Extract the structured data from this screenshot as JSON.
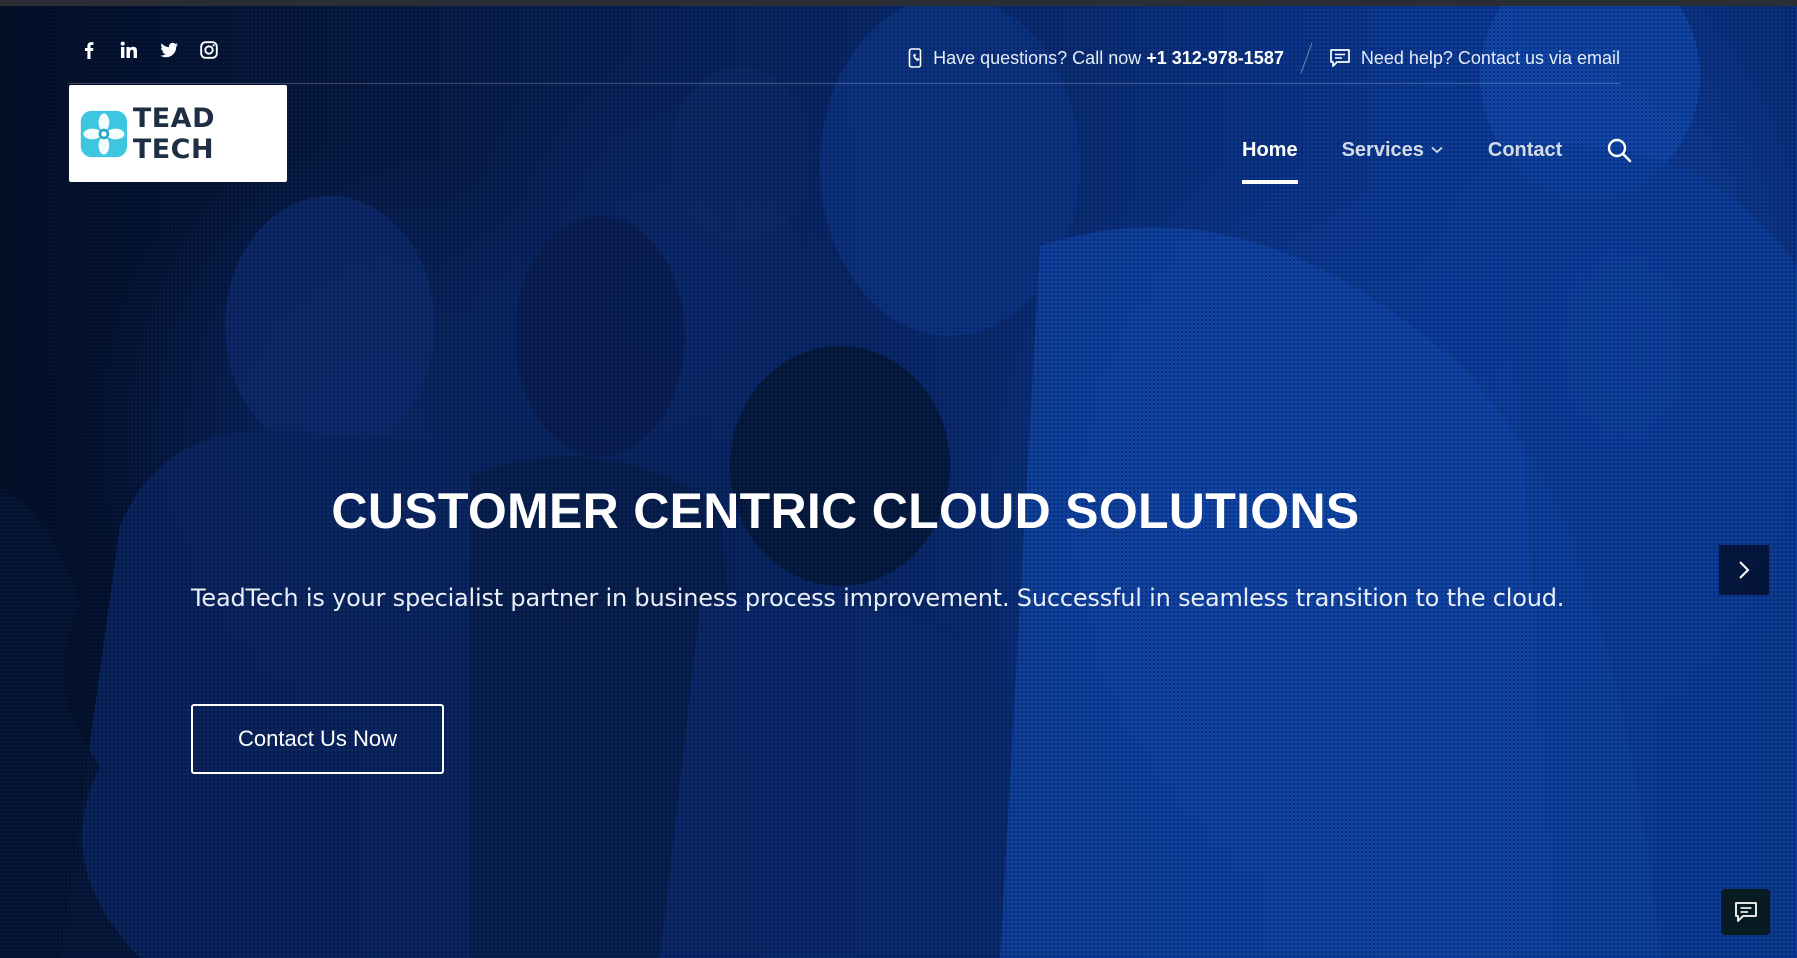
{
  "topbar": {
    "social": [
      {
        "icon": "facebook-icon"
      },
      {
        "icon": "linkedin-icon"
      },
      {
        "icon": "twitter-icon"
      },
      {
        "icon": "instagram-icon"
      }
    ],
    "phone": {
      "icon": "phone-icon",
      "prefix": "Have questions? Call now ",
      "number": "+1 312-978-1587"
    },
    "email": {
      "icon": "chat-icon",
      "text": "Need help? Contact us via email"
    }
  },
  "logo": {
    "text": "TEAD TECH",
    "icon_color": "#3ec6e0"
  },
  "nav": {
    "items": [
      {
        "label": "Home",
        "active": true
      },
      {
        "label": "Services",
        "has_dropdown": true
      },
      {
        "label": "Contact"
      }
    ],
    "search_icon": "search-icon"
  },
  "hero": {
    "headline": "CUSTOMER CENTRIC CLOUD SOLUTIONS",
    "subline": "TeadTech is your specialist partner in business process improvement. Successful in seamless transition to the cloud.",
    "cta_label": "Contact Us Now",
    "next_icon": "chevron-right-icon"
  },
  "chat_widget": {
    "icon": "chat-bubble-icon"
  },
  "colors": {
    "hero_overlay": "#0a2f7c",
    "text": "#ffffff"
  }
}
